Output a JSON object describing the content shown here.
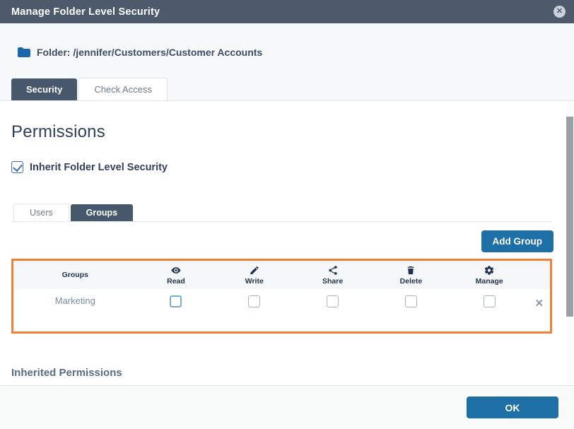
{
  "dialog": {
    "title": "Manage Folder Level Security",
    "close_icon": "circle-x-icon"
  },
  "folder": {
    "icon": "folder-icon",
    "label": "Folder:",
    "path": "/jennifer/Customers/Customer Accounts"
  },
  "tabs": [
    {
      "label": "Security",
      "active": true
    },
    {
      "label": "Check Access",
      "active": false
    }
  ],
  "permissions": {
    "heading": "Permissions",
    "inherit_label": "Inherit Folder Level Security",
    "inherit_checked": "true"
  },
  "subtabs": [
    {
      "label": "Users",
      "active": false
    },
    {
      "label": "Groups",
      "active": true
    }
  ],
  "add_group_button": "Add Group",
  "table": {
    "group_column_header": "Groups",
    "permission_columns": [
      {
        "label": "Read",
        "icon": "eye-icon"
      },
      {
        "label": "Write",
        "icon": "pencil-icon"
      },
      {
        "label": "Share",
        "icon": "share-icon"
      },
      {
        "label": "Delete",
        "icon": "trash-icon"
      },
      {
        "label": "Manage",
        "icon": "gear-icon"
      }
    ],
    "rows": [
      {
        "group": "Marketing",
        "read": false,
        "write": false,
        "share": false,
        "delete": false,
        "manage": false,
        "remove_icon": "x-icon",
        "remove_glyph": "✕"
      }
    ]
  },
  "inherited_heading": "Inherited Permissions",
  "footer": {
    "ok_button": "OK"
  },
  "colors": {
    "titlebar": "#4d5a6b",
    "active_tab": "#47586d",
    "accent_blue": "#1d6fa5",
    "folder_blue": "#1a66ad",
    "table_border_orange": "#f08138",
    "icon_navy": "#1f3350"
  }
}
